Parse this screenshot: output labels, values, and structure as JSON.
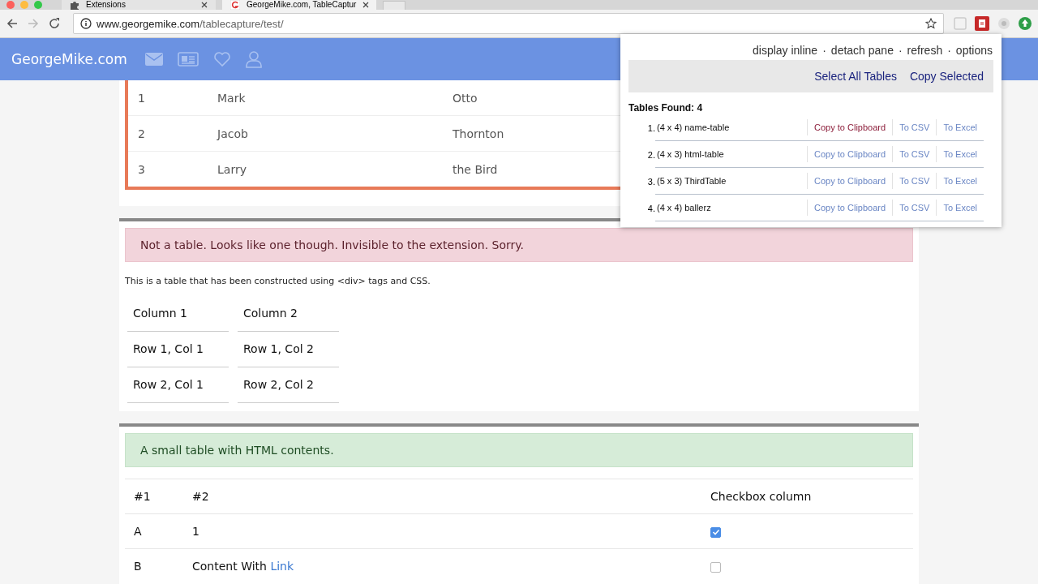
{
  "browser": {
    "tabs": [
      {
        "label": "Extensions",
        "selected": false
      },
      {
        "label": "GeorgeMike.com, TableCaptur",
        "selected": true
      }
    ],
    "address": {
      "domain": "www.georgemike.com",
      "path": "/tablecapture/test/"
    }
  },
  "site_header": {
    "logo": "GeorgeMike.com"
  },
  "name_table": {
    "rows": [
      [
        "1",
        "Mark",
        "Otto"
      ],
      [
        "2",
        "Jacob",
        "Thornton"
      ],
      [
        "3",
        "Larry",
        "the Bird"
      ]
    ]
  },
  "div_section": {
    "alert": "Not a table. Looks like one though. Invisible to the extension. Sorry.",
    "description": "This is a table that has been constructed using <div> tags and CSS.",
    "columns": [
      "Column 1",
      "Column 2"
    ],
    "rows": [
      [
        "Row 1, Col 1",
        "Row 1, Col 2"
      ],
      [
        "Row 2, Col 1",
        "Row 2, Col 2"
      ]
    ]
  },
  "html_section": {
    "alert": "A small table with HTML contents.",
    "columns": [
      "#1",
      "#2",
      "Checkbox column"
    ],
    "rows": [
      {
        "col1": "A",
        "text": "1",
        "checked": true
      },
      {
        "col1": "B",
        "text": "Content With ",
        "link": "Link",
        "checked": false
      }
    ]
  },
  "popup": {
    "menu": [
      "display inline",
      "detach pane",
      "refresh",
      "options"
    ],
    "separators": [
      "·",
      "·",
      "·"
    ],
    "actions": [
      "Select All Tables",
      "Copy Selected"
    ],
    "found_label": "Tables Found: 4",
    "tables": [
      {
        "number": "1.",
        "label": "(4 x 4) name-table",
        "links": [
          {
            "label": "Copy to Clipboard",
            "hovered": true
          },
          {
            "label": "To CSV",
            "hovered": false
          },
          {
            "label": "To Excel",
            "hovered": false
          }
        ]
      },
      {
        "number": "2.",
        "label": "(4 x 3) html-table",
        "links": [
          {
            "label": "Copy to Clipboard",
            "hovered": false
          },
          {
            "label": "To CSV",
            "hovered": false
          },
          {
            "label": "To Excel",
            "hovered": false
          }
        ]
      },
      {
        "number": "3.",
        "label": "(5 x 3) ThirdTable",
        "links": [
          {
            "label": "Copy to Clipboard",
            "hovered": false
          },
          {
            "label": "To CSV",
            "hovered": false
          },
          {
            "label": "To Excel",
            "hovered": false
          }
        ]
      },
      {
        "number": "4.",
        "label": "(4 x 4) ballerz",
        "links": [
          {
            "label": "Copy to Clipboard",
            "hovered": false
          },
          {
            "label": "To CSV",
            "hovered": false
          },
          {
            "label": "To Excel",
            "hovered": false
          }
        ]
      }
    ]
  }
}
